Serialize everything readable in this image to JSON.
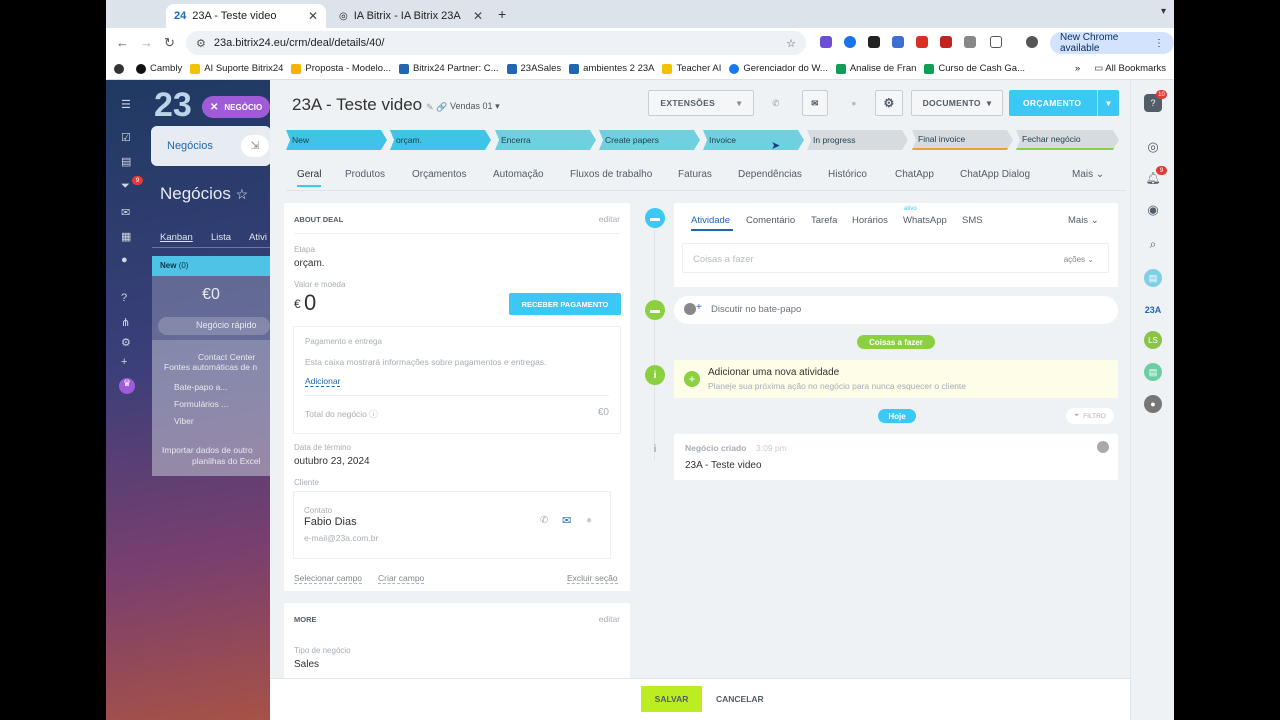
{
  "browser": {
    "tabs": [
      {
        "icon": "24",
        "title": "23A - Teste video"
      },
      {
        "icon": "globe-icon",
        "title": "IA Bitrix - IA Bitrix 23A"
      }
    ],
    "url": "23a.bitrix24.eu/crm/deal/details/40/",
    "new_chrome": "New Chrome available",
    "bookmarks": [
      {
        "label": "Cambly",
        "color": "#111111"
      },
      {
        "label": "AI Suporte Bitrix24",
        "color": "#f2c200"
      },
      {
        "label": "Proposta - Modelo...",
        "color": "#f4b400"
      },
      {
        "label": "Bitrix24 Partner: C...",
        "color": "#2066b0"
      },
      {
        "label": "23ASales",
        "color": "#2066b0"
      },
      {
        "label": "ambientes 2 23A",
        "color": "#2066b0"
      },
      {
        "label": "Teacher AI",
        "color": "#f2c200"
      },
      {
        "label": "Gerenciador do W...",
        "color": "#1877f2"
      },
      {
        "label": "Analise de Fran",
        "color": "#0f9d58"
      },
      {
        "label": "Curso de Cash Ga...",
        "color": "#0f9d58"
      }
    ],
    "all_bookmarks": "All Bookmarks"
  },
  "background": {
    "logo": "23",
    "deal_tag": "NEGÓCIO",
    "panel_tab": "Negócios",
    "title": "Negócios",
    "views": [
      "Kanban",
      "Lista",
      "Ativi"
    ],
    "column_title": "New",
    "column_count": "(0)",
    "column_sum": "€0",
    "quick_add": "Negócio rápido",
    "contact_center": "Contact Center",
    "auto_sources": "Fontes automáticas de n",
    "sources": [
      "Bate-papo a...",
      "Formulários ...",
      "Viber"
    ],
    "import_line1": "Importar dados de outro",
    "import_line2": "planilhas do Excel",
    "badge_count": "9"
  },
  "deal": {
    "title": "23A - Teste video",
    "pipeline": "Vendas 01",
    "buttons": {
      "extensions": "EXTENSÕES",
      "document": "DOCUMENTO",
      "quote": "ORÇAMENTO"
    },
    "stages": [
      {
        "label": "New",
        "color": "#3fc3e6"
      },
      {
        "label": "orçam.",
        "color": "#3fc3e6"
      },
      {
        "label": "Encerra",
        "color": "#6fd1df"
      },
      {
        "label": "Create papers",
        "color": "#6fd1df"
      },
      {
        "label": "Invoice",
        "color": "#6fd1df"
      },
      {
        "label": "In progress",
        "color": "#d6dbe0"
      },
      {
        "label": "Final invoice",
        "color": "#d6dbe0"
      },
      {
        "label": "Fechar negócio",
        "color": "#d6dbe0"
      }
    ],
    "tabs": [
      "Geral",
      "Produtos",
      "Orçamentos",
      "Automação",
      "Fluxos de trabalho",
      "Faturas",
      "Dependências",
      "Histórico",
      "ChatApp",
      "ChatApp Dialog",
      "Mais"
    ],
    "about": {
      "heading": "ABOUT DEAL",
      "edit": "editar",
      "stage_label": "Etapa",
      "stage_value": "orçam.",
      "amount_label": "Valor e moeda",
      "currency": "€",
      "amount": "0",
      "receive_payment": "RECEBER PAGAMENTO",
      "payment_label": "Pagamento e entrega",
      "payment_hint": "Esta caixa mostrará informações sobre pagamentos e entregas.",
      "add": "Adicionar",
      "total_label": "Total do negócio",
      "total_value": "€0",
      "end_date_label": "Data de término",
      "end_date": "outubro 23, 2024",
      "client_label": "Cliente",
      "contact_label": "Contato",
      "contact_name": "Fabio Dias",
      "contact_email": "e-mail@23a.com.br",
      "select_field": "Selecionar campo",
      "create_field": "Criar campo",
      "delete_section": "Excluir seção"
    },
    "more": {
      "heading": "MORE",
      "edit": "editar",
      "type_label": "Tipo de negócio",
      "type_value": "Sales"
    },
    "activity": {
      "tabs": [
        "Atividade",
        "Comentário",
        "Tarefa",
        "Horários",
        "WhatsApp",
        "SMS",
        "Mais"
      ],
      "whatsapp_badge": "ativo",
      "todo_placeholder": "Coisas a fazer",
      "actions": "ações",
      "chat": "Discutir no bate-papo",
      "todo_pill": "Coisas a fazer",
      "new_activity_title": "Adicionar uma nova atividade",
      "new_activity_desc": "Planeje sua próxima ação no negócio para nunca esquecer o cliente",
      "today": "Hoje",
      "filter": "FILTRO",
      "created_label": "Negócio criado",
      "created_time": "3:09 pm",
      "created_title": "23A - Teste video"
    },
    "footer": {
      "save": "SALVAR",
      "cancel": "CANCELAR"
    },
    "right_bar": {
      "help_badge": "10",
      "bell_badge": "9",
      "logo": "23A",
      "avatar_initials": "LS"
    }
  }
}
